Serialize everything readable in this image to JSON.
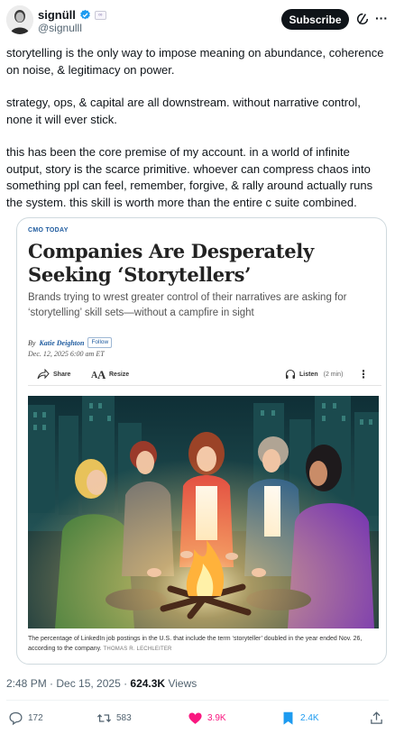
{
  "author": {
    "display_name": "signüll",
    "handle": "@signulll",
    "verified": true
  },
  "header": {
    "subscribe_label": "Subscribe",
    "more_glyph": "···"
  },
  "tweet": {
    "paragraphs": [
      "storytelling is the only way to impose meaning on abundance, coherence on noise, & legitimacy on power.",
      "strategy, ops, & capital are all downstream. without narrative control, none it will ever stick.",
      "this has been the core premise of my account. in a world of infinite output, story is the scarce primitive. whoever can compress chaos into something ppl can feel, remember, forgive, & rally around actually runs the system. this skill is worth more than the entire c suite combined."
    ]
  },
  "article": {
    "kicker": "CMO TODAY",
    "headline": "Companies Are Desperately Seeking ‘Storytellers’",
    "dek": "Brands trying to wrest greater control of their narratives are asking for ‘storytelling’ skill sets—without a campfire in sight",
    "byline_prefix": "By",
    "author": "Katie Deighton",
    "follow_label": "Follow",
    "date": "Dec. 12, 2025 6:00 am ET",
    "share_label": "Share",
    "resize_label": "Resize",
    "listen_label": "Listen",
    "listen_duration": "(2 min)",
    "kebab_glyph": "⋮",
    "caption": "The percentage of LinkedIn job postings in the U.S. that include the term ‘storyteller’ doubled in the year ended Nov. 26, according to the company.",
    "photo_credit": "THOMAS R. LECHLEITER"
  },
  "meta": {
    "time_date": "2:48 PM · Dec 15, 2025 · ",
    "views_count": "624.3K",
    "views_label": " Views"
  },
  "engagement": {
    "replies": "172",
    "reposts": "583",
    "likes": "3.9K",
    "bookmarks": "2.4K"
  },
  "colors": {
    "accent_blue": "#1d9bf0",
    "like_pink": "#f91880",
    "wsj_blue": "#1d5a9e",
    "text_primary": "#0f1419",
    "text_secondary": "#536471"
  }
}
